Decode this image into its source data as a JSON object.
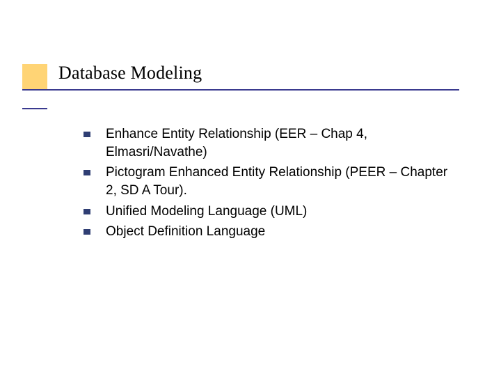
{
  "title": "Database Modeling",
  "bullets": [
    "Enhance Entity Relationship (EER – Chap 4, Elmasri/Navathe)",
    "Pictogram Enhanced Entity Relationship (PEER – Chapter 2, SD A Tour).",
    "Unified Modeling Language (UML)",
    "Object Definition Language"
  ]
}
